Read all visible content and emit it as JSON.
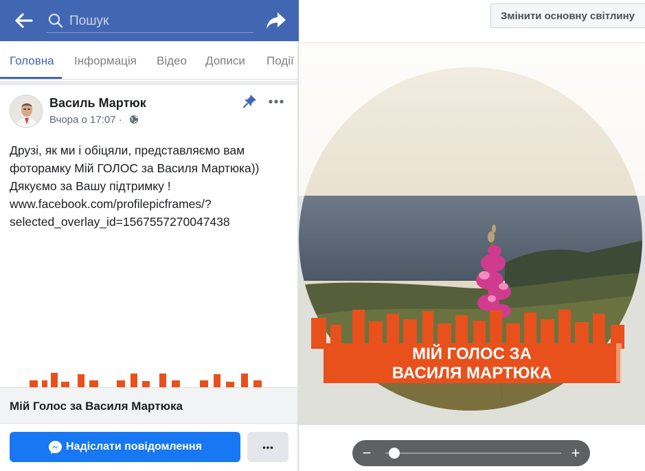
{
  "mobile": {
    "search_placeholder": "Пошук",
    "tabs": [
      {
        "label": "Головна",
        "active": true
      },
      {
        "label": "Інформація",
        "active": false
      },
      {
        "label": "Відео",
        "active": false
      },
      {
        "label": "Дописи",
        "active": false
      },
      {
        "label": "Події",
        "active": false
      }
    ],
    "post": {
      "author": "Василь Мартюк",
      "time": "Вчора о 17:07 ·",
      "text_lines": [
        "Друзі, як ми і обіцяли, представляємо вам",
        "фоторамку Мій ГОЛОС за Василя Мартюка))",
        "Дякуємо за Вашу підтримку !",
        "www.facebook.com/profilepicframes/?",
        "selected_overlay_id=1567557270047438"
      ]
    },
    "link_card": {
      "title": "Мій Голос за Василя Мартюка"
    },
    "actions": {
      "message_label": "Надіслати повідомлення"
    },
    "colors": {
      "brand": "#4267b2",
      "button": "#1877f2",
      "frame_orange": "#e8501c"
    }
  },
  "editor": {
    "change_photo_label": "Змінити основну світлину",
    "frame_lines": [
      "МІЙ ГОЛОС ЗА",
      "ВАСИЛЯ МАРТЮКА"
    ],
    "zoom_level": 0.05,
    "zoom_minus": "−",
    "zoom_plus": "+"
  }
}
